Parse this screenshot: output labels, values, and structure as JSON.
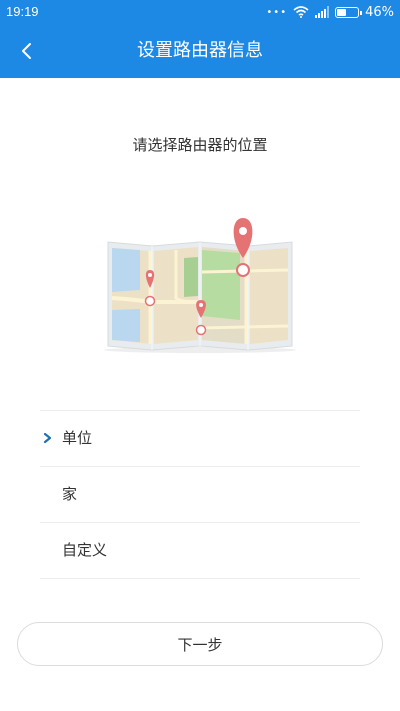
{
  "status_bar": {
    "time": "19:19",
    "dots": "•••",
    "battery_percent": "46%",
    "battery_level": 0.46,
    "icons": [
      "wifi-icon",
      "signal-icon",
      "battery-icon"
    ]
  },
  "header": {
    "title": "设置路由器信息",
    "back_icon": "chevron-left-icon"
  },
  "main": {
    "prompt": "请选择路由器的位置",
    "illustration": "map-with-pins"
  },
  "options": [
    {
      "label": "单位",
      "selected": true
    },
    {
      "label": "家",
      "selected": false
    },
    {
      "label": "自定义",
      "selected": false
    }
  ],
  "footer": {
    "next_label": "下一步"
  },
  "colors": {
    "primary": "#1e88e5",
    "check": "#1e6fb5",
    "pin": "#e57373"
  }
}
